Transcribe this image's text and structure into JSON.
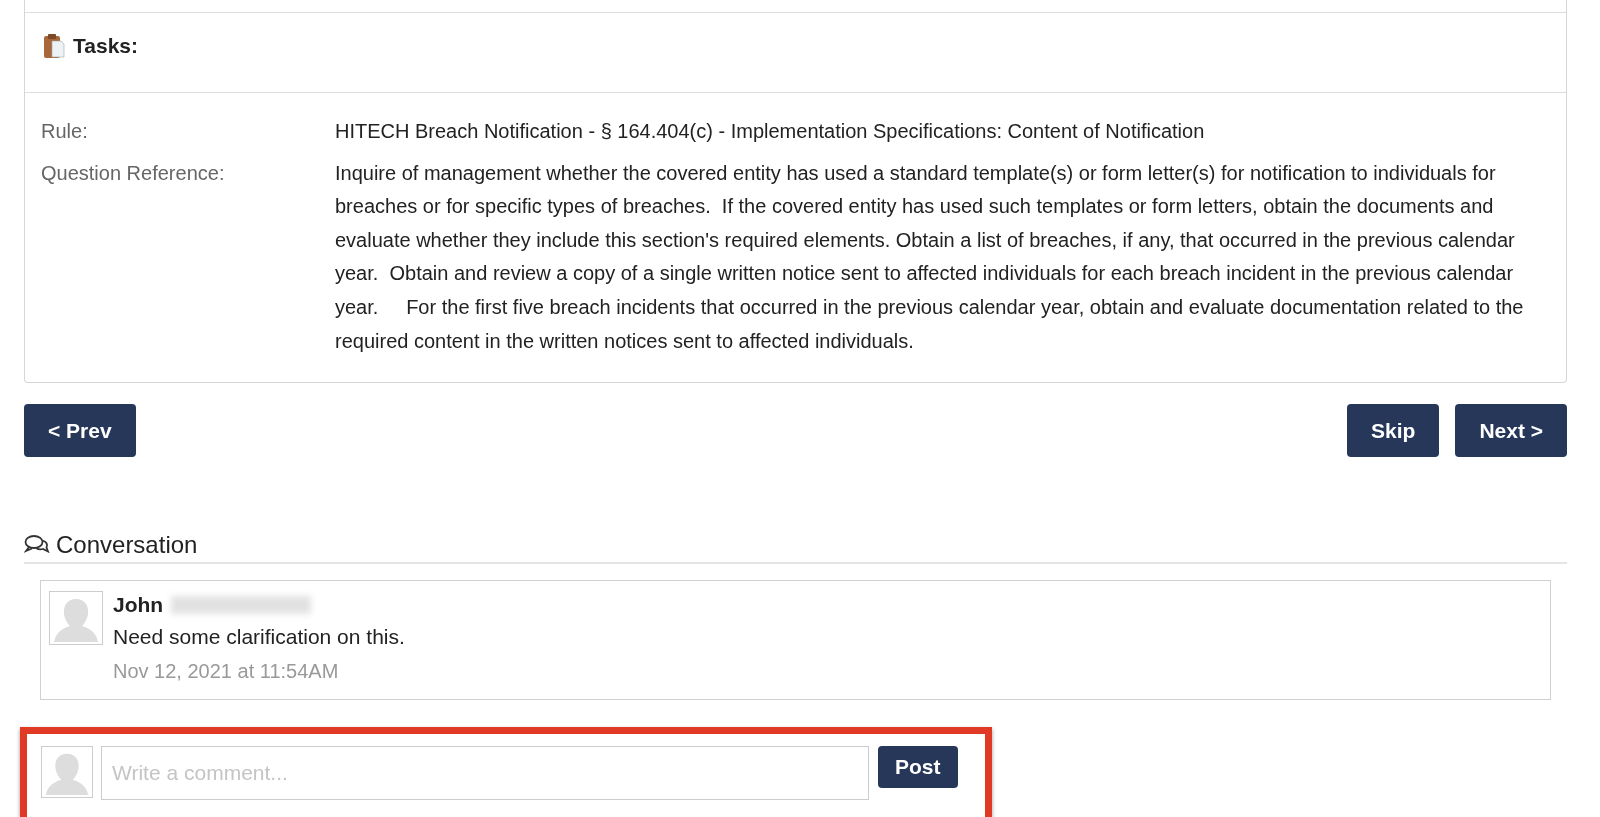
{
  "tasks": {
    "title": "Tasks:"
  },
  "details": [
    {
      "label": "Rule:",
      "value": "HITECH Breach Notification - § 164.404(c) - Implementation Specifications: Content of Notification"
    },
    {
      "label": "Question Reference:",
      "value": "Inquire of management whether the covered entity has used a standard template(s) or form letter(s) for notification to individuals for breaches or for specific types of breaches.  If the covered entity has used such templates or form letters, obtain the documents and evaluate whether they include this section's required elements. Obtain a list of breaches, if any, that occurred in the previous calendar year.  Obtain and review a copy of a single written notice sent to affected individuals for each breach incident in the previous calendar year.     For the first five breach incidents that occurred in the previous calendar year, obtain and evaluate documentation related to the required content in the written notices sent to affected individuals."
    }
  ],
  "navigation": {
    "prev": "< Prev",
    "skip": "Skip",
    "next": "Next >"
  },
  "conversation": {
    "title": "Conversation",
    "comments": [
      {
        "author": "John",
        "text": "Need some clarification on this.",
        "time": "Nov 12, 2021 at 11:54AM"
      }
    ],
    "new_comment": {
      "placeholder": "Write a comment...",
      "button": "Post"
    }
  }
}
